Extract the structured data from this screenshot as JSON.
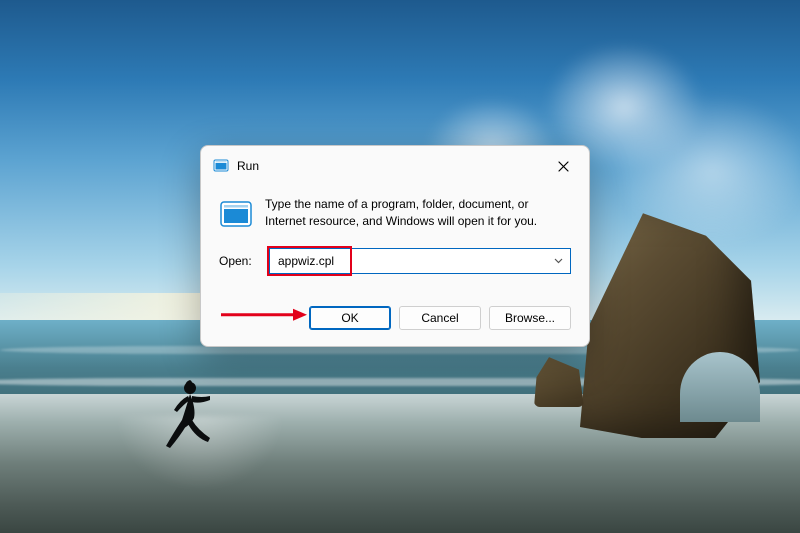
{
  "dialog": {
    "title": "Run",
    "description": "Type the name of a program, folder, document, or Internet resource, and Windows will open it for you.",
    "open_label": "Open:",
    "open_value": "appwiz.cpl",
    "buttons": {
      "ok": "OK",
      "cancel": "Cancel",
      "browse": "Browse..."
    }
  },
  "annotations": {
    "highlight_color": "#e2001a",
    "arrow_color": "#e2001a"
  }
}
